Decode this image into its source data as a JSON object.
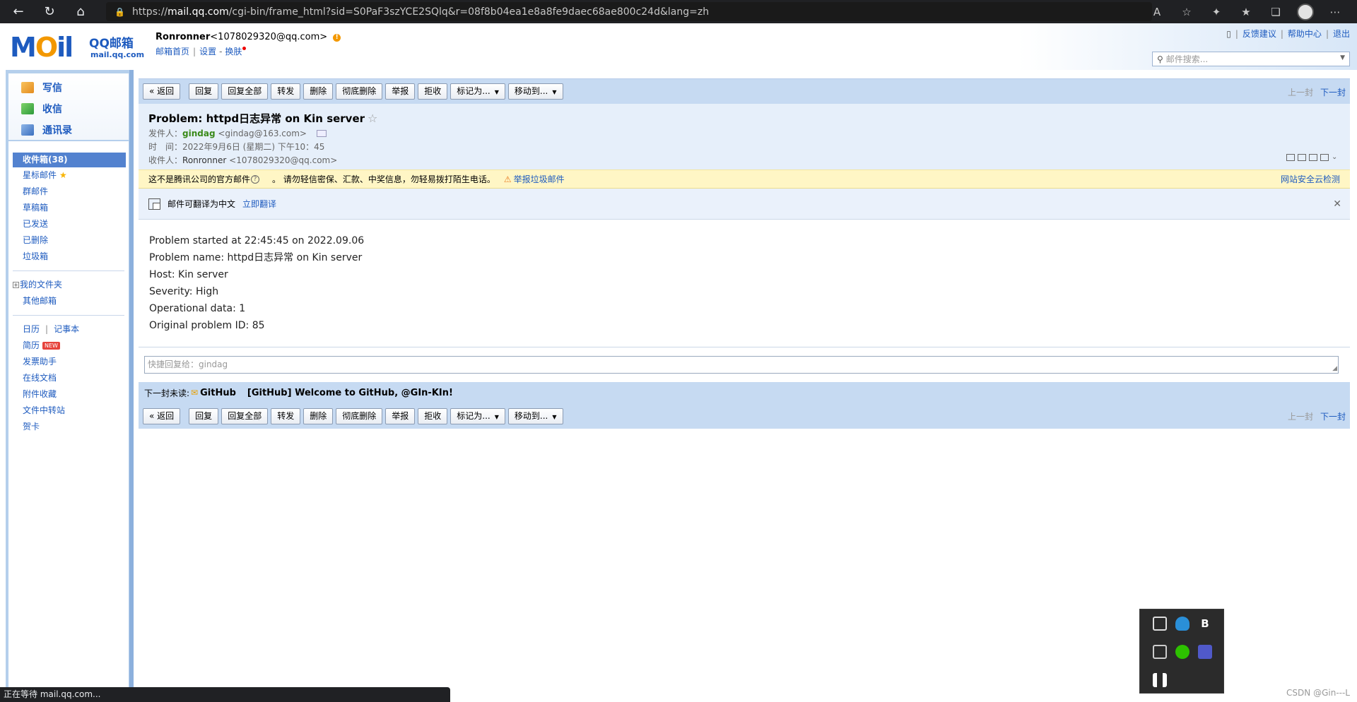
{
  "browser": {
    "url_prefix": "https://",
    "url_host": "mail.qq.com",
    "url_path": "/cgi-bin/frame_html?sid=S0PaF3szYCE2SQlq&r=08f8b04ea1e8a8fe9daec68ae800c24d&lang=zh",
    "status_text": "正在等待 mail.qq.com..."
  },
  "header": {
    "logo_text": "M",
    "logo_o": "O",
    "logo_il": "il",
    "logo_cn": "QQ邮箱",
    "logo_sub": "mail.qq.com",
    "user_name": "Ronronner",
    "user_email": "<1078029320@qq.com>",
    "warn_mark": "!",
    "links": {
      "home": "邮箱首页",
      "settings": "设置",
      "dash": "-",
      "skin": "换肤"
    },
    "top_links": {
      "feedback": "反馈建议",
      "help": "帮助中心",
      "logout": "退出"
    },
    "search_placeholder": "邮件搜索..."
  },
  "sidebar": {
    "compose": "写信",
    "receive": "收信",
    "contacts": "通讯录",
    "folders": [
      {
        "label": "收件箱(38)"
      },
      {
        "label": "星标邮件"
      },
      {
        "label": "群邮件"
      },
      {
        "label": "草稿箱"
      },
      {
        "label": "已发送"
      },
      {
        "label": "已删除"
      },
      {
        "label": "垃圾箱"
      }
    ],
    "my_folders": "我的文件夹",
    "other_mail": "其他邮箱",
    "calendar": "日历",
    "notes": "记事本",
    "resume": "简历",
    "new_badge": "NEW",
    "tools": [
      "发票助手",
      "在线文档",
      "附件收藏",
      "文件中转站",
      "贺卡"
    ]
  },
  "toolbar": {
    "back": "« 返回",
    "reply": "回复",
    "reply_all": "回复全部",
    "forward": "转发",
    "delete": "删除",
    "delete_perm": "彻底删除",
    "report": "举报",
    "reject": "拒收",
    "mark_as": "标记为...",
    "move_to": "移动到...",
    "prev": "上一封",
    "next": "下一封"
  },
  "mail": {
    "subject": "Problem: httpd日志异常 on Kin server",
    "from_label": "发件人：",
    "from_name": "gindag",
    "from_addr": "<gindag@163.com>",
    "time_label": "时　间：",
    "time_value": "2022年9月6日 (星期二) 下午10：45",
    "to_label": "收件人：",
    "to_name": "Ronronner",
    "to_addr": "<1078029320@qq.com>",
    "warning_text": "这不是腾讯公司的官方邮件",
    "warning_q": "?",
    "warning_advice": "。 请勿轻信密保、汇款、中奖信息，勿轻易拨打陌生电话。",
    "report_spam": "举报垃圾邮件",
    "cloud_check": "网站安全云检测",
    "translate_text": "邮件可翻译为中文",
    "translate_link": "立即翻译",
    "body_lines": [
      "Problem started at 22:45:45 on 2022.09.06",
      "Problem name: httpd日志异常 on Kin server",
      "Host: Kin server",
      "Severity: High",
      "Operational data: 1",
      "Original problem ID: 85"
    ],
    "quick_reply_placeholder": "快捷回复给：gindag",
    "next_unread_label": "下一封未读:",
    "next_unread_from": "GitHub",
    "next_unread_subject": "[GitHub] Welcome to GitHub, @GIn-KIn!"
  },
  "watermark": "CSDN @Gin---L"
}
